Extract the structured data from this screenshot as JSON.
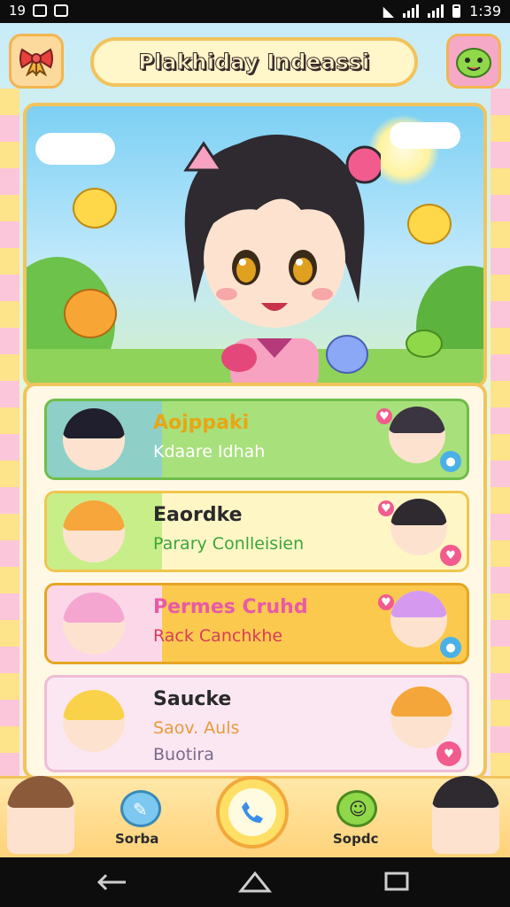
{
  "status_bar": {
    "left_text": "19",
    "time": "1:39"
  },
  "header": {
    "title": "Plakhiday Indeassi",
    "left_icon": "bow-icon",
    "right_icon": "slime-face-icon"
  },
  "contacts": [
    {
      "name": "Aojppaki",
      "subtitle": "Kdaare Idhah",
      "extra": "",
      "colors": {
        "bg": "#a8e07c",
        "border": "#6fbd4a",
        "name": "#e8a614",
        "sub": "#ffffff"
      }
    },
    {
      "name": "Eaordke",
      "subtitle": "Parary Conlleisien",
      "extra": "",
      "colors": {
        "bg": "#fff6c6",
        "border": "#f0c64d",
        "name": "#2a2a2a",
        "sub": "#3aa63a"
      }
    },
    {
      "name": "Permes Cruhd",
      "subtitle": "Rack Canchkhe",
      "extra": "",
      "colors": {
        "bg": "#fcc94f",
        "border": "#e6a523",
        "name": "#e85aa6",
        "sub": "#d73d56"
      }
    },
    {
      "name": "Saucke",
      "subtitle": "Saov. Auls",
      "extra": "Buotira",
      "colors": {
        "bg": "#fbe7f2",
        "border": "#f0bcd6",
        "name": "#2a2a2a",
        "sub": "#e89a3a"
      }
    }
  ],
  "bottom_nav": {
    "left_label": "Sorba",
    "right_label": "Sopdc",
    "call_icon": "phone-icon"
  }
}
